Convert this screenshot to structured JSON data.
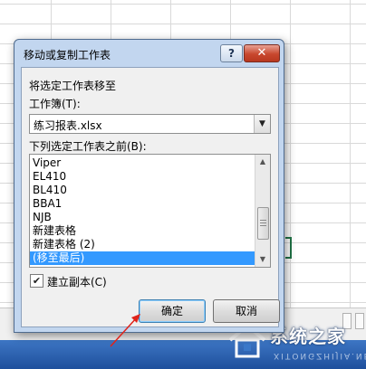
{
  "dialog": {
    "title": "移动或复制工作表",
    "help_icon": "?",
    "close_icon": "✕",
    "move_to_label": "将选定工作表移至",
    "workbook_label": "工作簿(T):",
    "workbook_value": "练习报表.xlsx",
    "before_sheet_label": "下列选定工作表之前(B):",
    "sheets": [
      "Viper",
      "EL410",
      "BL410",
      "BBA1",
      "NJB",
      "新建表格",
      "新建表格 (2)",
      "(移至最后)"
    ],
    "selected_sheet": "(移至最后)",
    "create_copy_label": "建立副本(C)",
    "create_copy_checked": true,
    "ok_label": "确定",
    "cancel_label": "取消"
  },
  "watermark": {
    "text": "系统之家",
    "sub": "XITONGZHIJIA.NET"
  },
  "colors": {
    "selection": "#3399ff",
    "annotation_arrow": "#e0241b",
    "title_bar": "#c2d6ef"
  }
}
